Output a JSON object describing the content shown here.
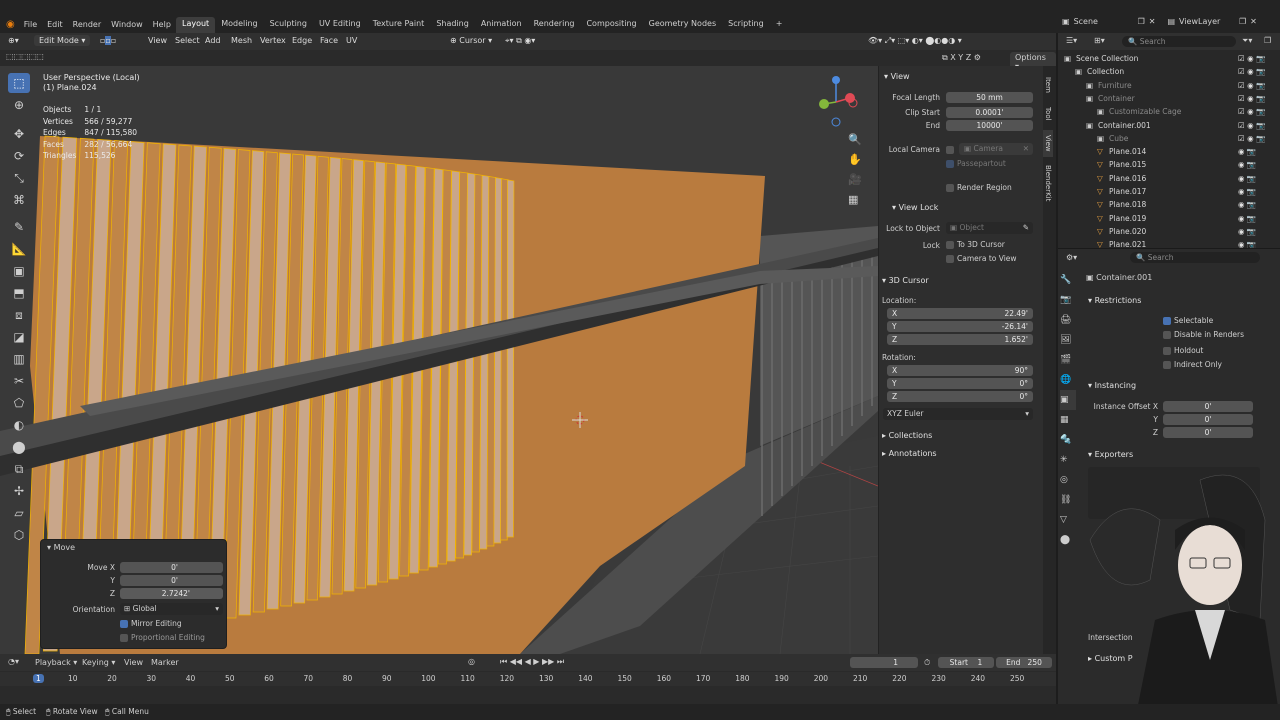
{
  "menu": [
    "File",
    "Edit",
    "Render",
    "Window",
    "Help"
  ],
  "workspaces": [
    "Layout",
    "Modeling",
    "Sculpting",
    "UV Editing",
    "Texture Paint",
    "Shading",
    "Animation",
    "Rendering",
    "Compositing",
    "Geometry Nodes",
    "Scripting"
  ],
  "active_workspace": "Layout",
  "scene": "Scene",
  "view_layer": "ViewLayer",
  "vp_header": {
    "mode": "Edit Mode",
    "items": [
      "View",
      "Select",
      "Add",
      "Mesh",
      "Vertex",
      "Edge",
      "Face",
      "UV"
    ],
    "transform_pivot": "Cursor",
    "options": "Options",
    "axes": [
      "X",
      "Y",
      "Z"
    ]
  },
  "viewport_info": {
    "view": "User Perspective (Local)",
    "object": "(1) Plane.024"
  },
  "stats": [
    {
      "label": "Objects",
      "value": "1 / 1"
    },
    {
      "label": "Vertices",
      "value": "566 / 59,277"
    },
    {
      "label": "Edges",
      "value": "847 / 115,580"
    },
    {
      "label": "Faces",
      "value": "282 / 56,664"
    },
    {
      "label": "Triangles",
      "value": "115,526"
    }
  ],
  "npanel": {
    "view_section": "View",
    "focal_length_label": "Focal Length",
    "focal_length": "50 mm",
    "clip_start_label": "Clip Start",
    "clip_start": "0.0001'",
    "end_label": "End",
    "end": "10000'",
    "local_camera_label": "Local Camera",
    "camera_placeholder": "Camera",
    "passepartout": "Passepartout",
    "render_region": "Render Region",
    "view_lock": "View Lock",
    "lock_to_object_label": "Lock to Object",
    "object_placeholder": "Object",
    "lock_label": "Lock",
    "to_3d_cursor": "To 3D Cursor",
    "camera_to_view": "Camera to View",
    "cursor_section": "3D Cursor",
    "location_label": "Location:",
    "loc_x": "22.49'",
    "loc_y": "-26.14'",
    "loc_z": "1.652'",
    "rotation_label": "Rotation:",
    "rot_x": "90°",
    "rot_y": "0°",
    "rot_z": "0°",
    "rotation_mode": "XYZ Euler",
    "collections": "Collections",
    "annotations": "Annotations",
    "tabs": [
      "Item",
      "Tool",
      "View",
      "BlenderKit"
    ]
  },
  "outliner": {
    "search_placeholder": "Search",
    "rows": [
      {
        "label": "Scene Collection",
        "indent": 0,
        "dim": false
      },
      {
        "label": "Collection",
        "indent": 1,
        "dim": false
      },
      {
        "label": "Furniture",
        "indent": 2,
        "dim": true
      },
      {
        "label": "Container",
        "indent": 2,
        "dim": true
      },
      {
        "label": "Customizable Cage",
        "indent": 3,
        "dim": true
      },
      {
        "label": "Container.001",
        "indent": 2,
        "dim": false
      },
      {
        "label": "Cube",
        "indent": 3,
        "dim": true
      },
      {
        "label": "Plane.014",
        "indent": 3,
        "dim": false
      },
      {
        "label": "Plane.015",
        "indent": 3,
        "dim": false
      },
      {
        "label": "Plane.016",
        "indent": 3,
        "dim": false
      },
      {
        "label": "Plane.017",
        "indent": 3,
        "dim": false
      },
      {
        "label": "Plane.018",
        "indent": 3,
        "dim": false
      },
      {
        "label": "Plane.019",
        "indent": 3,
        "dim": false
      },
      {
        "label": "Plane.020",
        "indent": 3,
        "dim": false
      },
      {
        "label": "Plane.021",
        "indent": 3,
        "dim": false
      }
    ]
  },
  "props": {
    "search_placeholder": "Search",
    "object_name": "Container.001",
    "restrictions": "Restrictions",
    "selectable": "Selectable",
    "disable_renders": "Disable in Renders",
    "holdout": "Holdout",
    "indirect_only": "Indirect Only",
    "instancing": "Instancing",
    "instance_offset_label": "Instance Offset X",
    "offset_x": "0'",
    "offset_y": "0'",
    "offset_z": "0'",
    "y_label": "Y",
    "z_label": "Z",
    "exporters": "Exporters",
    "intersection": "Intersection",
    "custom": "Custom P"
  },
  "move_panel": {
    "title": "Move",
    "move_x_label": "Move X",
    "move_x": "0'",
    "y_label": "Y",
    "y": "0'",
    "z_label": "Z",
    "z": "2.7242'",
    "orientation_label": "Orientation",
    "orientation": "Global",
    "mirror_editing": "Mirror Editing",
    "proportional_editing": "Proportional Editing"
  },
  "timeline": {
    "items": [
      "Playback",
      "Keying",
      "View",
      "Marker"
    ],
    "current_frame": "1",
    "start_label": "Start",
    "start": "1",
    "end_label": "End",
    "end": "250",
    "ticks": [
      "1",
      "10",
      "20",
      "30",
      "40",
      "50",
      "60",
      "70",
      "80",
      "90",
      "100",
      "110",
      "120",
      "130",
      "140",
      "150",
      "160",
      "170",
      "180",
      "190",
      "200",
      "210",
      "220",
      "230",
      "240",
      "250"
    ]
  },
  "status": [
    "Select",
    "Rotate View",
    "Call Menu"
  ],
  "colors": {
    "accent": "#4772b3",
    "selected_face": "#c8843e",
    "highlight_edge": "#f2b400",
    "viewport_bg": "#393939"
  }
}
